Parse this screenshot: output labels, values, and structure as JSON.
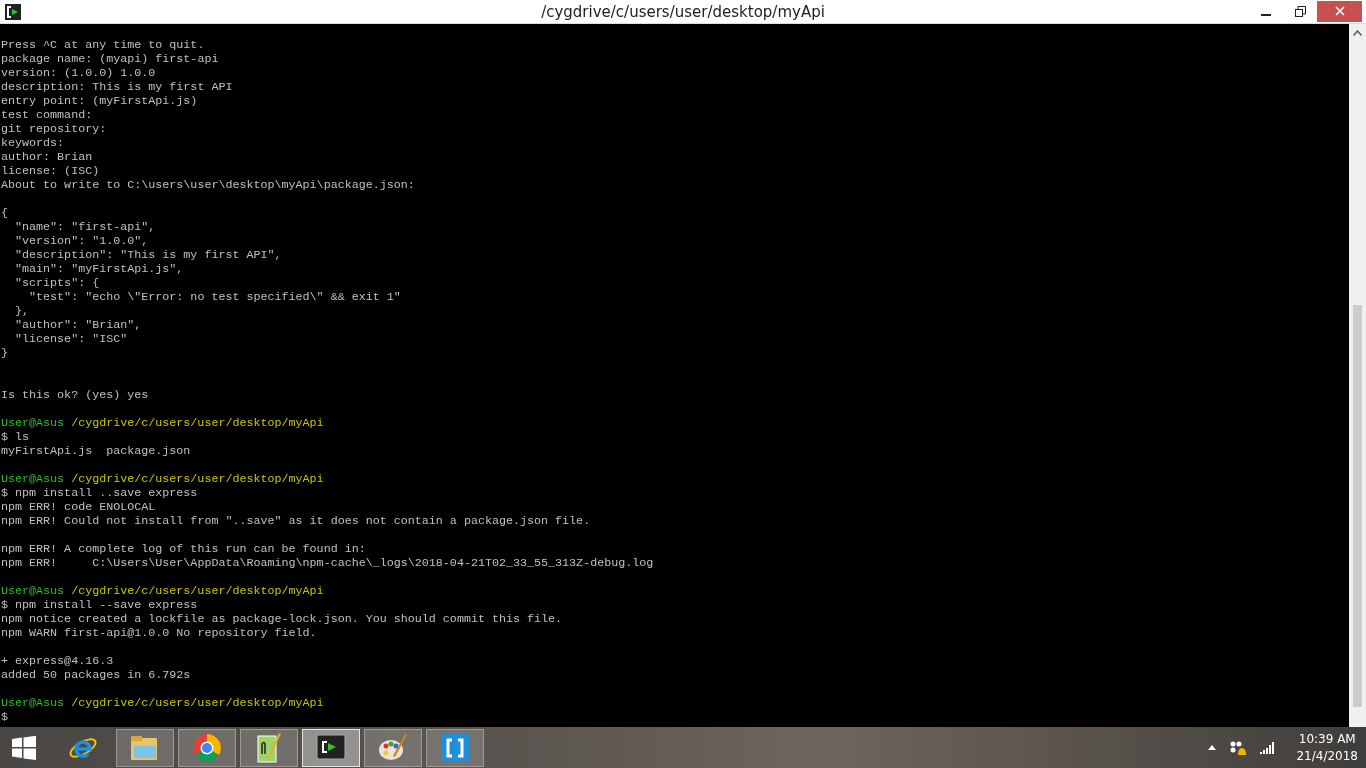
{
  "window": {
    "title": "/cygdrive/c/users/user/desktop/myApi"
  },
  "terminal": {
    "lines": [
      {
        "kind": "text",
        "text": "Press ^C at any time to quit."
      },
      {
        "kind": "text",
        "text": "package name: (myapi) first-api"
      },
      {
        "kind": "text",
        "text": "version: (1.0.0) 1.0.0"
      },
      {
        "kind": "text",
        "text": "description: This is my first API"
      },
      {
        "kind": "text",
        "text": "entry point: (myFirstApi.js)"
      },
      {
        "kind": "text",
        "text": "test command:"
      },
      {
        "kind": "text",
        "text": "git repository:"
      },
      {
        "kind": "text",
        "text": "keywords:"
      },
      {
        "kind": "text",
        "text": "author: Brian"
      },
      {
        "kind": "text",
        "text": "license: (ISC)"
      },
      {
        "kind": "text",
        "text": "About to write to C:\\users\\user\\desktop\\myApi\\package.json:"
      },
      {
        "kind": "blank"
      },
      {
        "kind": "text",
        "text": "{"
      },
      {
        "kind": "text",
        "text": "  \"name\": \"first-api\","
      },
      {
        "kind": "text",
        "text": "  \"version\": \"1.0.0\","
      },
      {
        "kind": "text",
        "text": "  \"description\": \"This is my first API\","
      },
      {
        "kind": "text",
        "text": "  \"main\": \"myFirstApi.js\","
      },
      {
        "kind": "text",
        "text": "  \"scripts\": {"
      },
      {
        "kind": "text",
        "text": "    \"test\": \"echo \\\"Error: no test specified\\\" && exit 1\""
      },
      {
        "kind": "text",
        "text": "  },"
      },
      {
        "kind": "text",
        "text": "  \"author\": \"Brian\","
      },
      {
        "kind": "text",
        "text": "  \"license\": \"ISC\""
      },
      {
        "kind": "text",
        "text": "}"
      },
      {
        "kind": "blank"
      },
      {
        "kind": "blank"
      },
      {
        "kind": "text",
        "text": "Is this ok? (yes) yes"
      },
      {
        "kind": "blank"
      },
      {
        "kind": "prompt",
        "user": "User@Asus",
        "path": "/cygdrive/c/users/user/desktop/myApi"
      },
      {
        "kind": "text",
        "text": "$ ls"
      },
      {
        "kind": "text",
        "text": "myFirstApi.js  package.json"
      },
      {
        "kind": "blank"
      },
      {
        "kind": "prompt",
        "user": "User@Asus",
        "path": "/cygdrive/c/users/user/desktop/myApi"
      },
      {
        "kind": "text",
        "text": "$ npm install ..save express"
      },
      {
        "kind": "text",
        "text": "npm ERR! code ENOLOCAL"
      },
      {
        "kind": "text",
        "text": "npm ERR! Could not install from \"..save\" as it does not contain a package.json file."
      },
      {
        "kind": "blank"
      },
      {
        "kind": "text",
        "text": "npm ERR! A complete log of this run can be found in:"
      },
      {
        "kind": "text",
        "text": "npm ERR!     C:\\Users\\User\\AppData\\Roaming\\npm-cache\\_logs\\2018-04-21T02_33_55_313Z-debug.log"
      },
      {
        "kind": "blank"
      },
      {
        "kind": "prompt",
        "user": "User@Asus",
        "path": "/cygdrive/c/users/user/desktop/myApi"
      },
      {
        "kind": "text",
        "text": "$ npm install --save express"
      },
      {
        "kind": "text",
        "text": "npm notice created a lockfile as package-lock.json. You should commit this file."
      },
      {
        "kind": "text",
        "text": "npm WARN first-api@1.0.0 No repository field."
      },
      {
        "kind": "blank"
      },
      {
        "kind": "text",
        "text": "+ express@4.16.3"
      },
      {
        "kind": "text",
        "text": "added 50 packages in 6.792s"
      },
      {
        "kind": "blank"
      },
      {
        "kind": "prompt",
        "user": "User@Asus",
        "path": "/cygdrive/c/users/user/desktop/myApi"
      },
      {
        "kind": "text",
        "text": "$"
      }
    ]
  },
  "taskbar": {
    "apps": [
      {
        "kind": "ie",
        "running": false,
        "selected": false
      },
      {
        "kind": "explorer",
        "running": true,
        "selected": false
      },
      {
        "kind": "chrome",
        "running": true,
        "selected": false
      },
      {
        "kind": "notepad",
        "running": true,
        "selected": false
      },
      {
        "kind": "terminal",
        "running": true,
        "selected": true
      },
      {
        "kind": "paint",
        "running": true,
        "selected": false
      },
      {
        "kind": "brackets",
        "running": true,
        "selected": false
      }
    ],
    "clock": {
      "time": "10:39 AM",
      "date": "21/4/2018"
    }
  }
}
